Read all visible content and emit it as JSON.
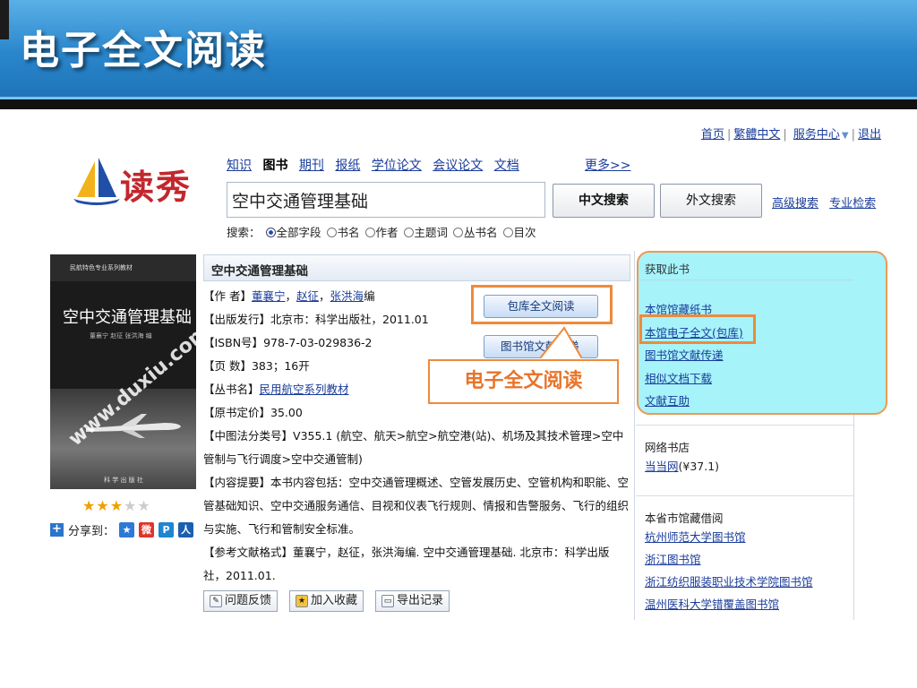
{
  "slide": {
    "title": "电子全文阅读"
  },
  "toplinks": {
    "home": "首页",
    "traditional": "繁體中文",
    "service": "服务中心",
    "logout": "退出"
  },
  "logo": {
    "text": "读秀"
  },
  "nav": {
    "tabs": [
      "知识",
      "图书",
      "期刊",
      "报纸",
      "学位论文",
      "会议论文",
      "文档"
    ],
    "active": "图书",
    "more": "更多>>"
  },
  "search": {
    "query": "空中交通管理基础",
    "btn_cn": "中文搜索",
    "btn_foreign": "外文搜索",
    "advanced": "高级搜索",
    "professional": "专业检索",
    "scope_label": "搜索：",
    "scopes": [
      "全部字段",
      "书名",
      "作者",
      "主题词",
      "丛书名",
      "目次"
    ],
    "scope_selected": 0
  },
  "cover": {
    "series": "民航特色专业系列教材",
    "title": "空中交通管理基础",
    "authors": "董襄宁  赵征  张洪海  编",
    "watermark": "www.duxiu.com",
    "publisher": "科 学 出 版 社"
  },
  "rating": {
    "stars": 3,
    "max": 5
  },
  "share": {
    "label": "分享到："
  },
  "book": {
    "title": "空中交通管理基础",
    "author_label": "【作 者】",
    "authors": [
      "董襄宁",
      "赵征",
      "张洪海"
    ],
    "author_suffix": "编",
    "publish_label": "【出版发行】",
    "publish": "北京市：科学出版社，2011.01",
    "isbn_label": "【ISBN号】",
    "isbn": "978-7-03-029836-2",
    "pages_label": "【页 数】",
    "pages": "383；16开",
    "series_label": "【丛书名】",
    "series": "民用航空系列教材",
    "price_label": "【原书定价】",
    "price": "35.00",
    "clc_label": "【中图法分类号】",
    "clc": "V355.1 (航空、航天>航空>航空港(站)、机场及其技术管理>空中管制与飞行调度>空中交通管制)",
    "summary_label": "【内容提要】",
    "summary": "本书内容包括：空中交通管理概述、空管发展历史、空管机构和职能、空管基础知识、空中交通服务通信、目视和仪表飞行规则、情报和告警服务、飞行的组织与实施、飞行和管制安全标准。",
    "cite_label": "【参考文献格式】",
    "cite": "董襄宁，赵征，张洪海编. 空中交通管理基础. 北京市：科学出版社，2011.01."
  },
  "buttons": {
    "read": "包库全文阅读",
    "deliver": "图书馆文献传递"
  },
  "callout": "电子全文阅读",
  "actions": {
    "feedback": "问题反馈",
    "favorite": "加入收藏",
    "export": "导出记录"
  },
  "sidebar": {
    "get_title": "获取此书",
    "get_links": [
      "本馆馆藏纸书",
      "本馆电子全文(包库)",
      "图书馆文献传递",
      "相似文档下载",
      "文献互助"
    ],
    "store_title": "网络书店",
    "store_link": "当当网",
    "store_price": "(¥37.1)",
    "borrow_title": "本省市馆藏借阅",
    "borrow_links": [
      "杭州师范大学图书馆",
      "浙江图书馆",
      "浙江纺织服装职业技术学院图书馆",
      "温州医科大学错覆盖图书馆"
    ]
  }
}
